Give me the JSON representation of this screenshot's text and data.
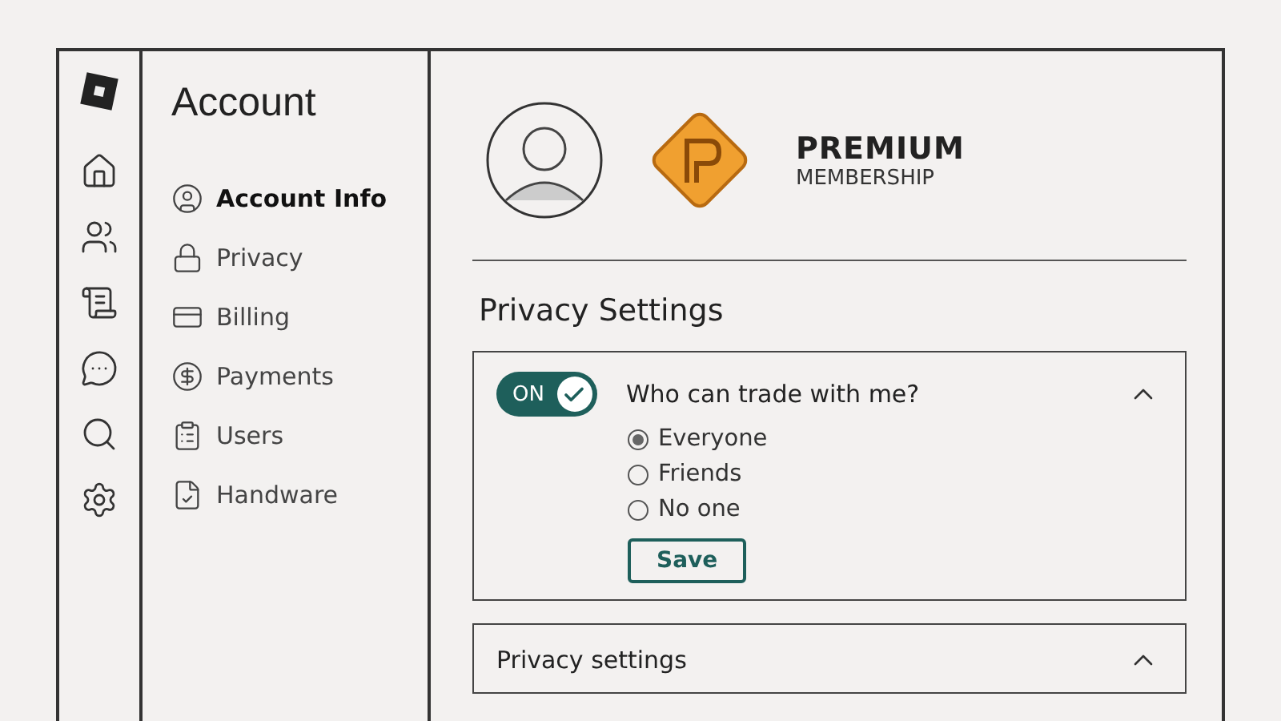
{
  "rail": {
    "items": [
      {
        "kind": "home",
        "selected": false
      },
      {
        "kind": "friends",
        "selected": false
      },
      {
        "kind": "scroll",
        "selected": false
      },
      {
        "kind": "chat",
        "selected": false
      },
      {
        "kind": "search",
        "selected": false
      },
      {
        "kind": "settings",
        "selected": false
      }
    ]
  },
  "sidebar": {
    "title": "Account",
    "items": [
      {
        "label": "Account Info",
        "kind": "user",
        "selected": true
      },
      {
        "label": "Privacy",
        "kind": "lock",
        "selected": false
      },
      {
        "label": "Billing",
        "kind": "card",
        "selected": false
      },
      {
        "label": "Payments",
        "kind": "dollar",
        "selected": false
      },
      {
        "label": "Users",
        "kind": "clipboard",
        "selected": false
      },
      {
        "label": "Handware",
        "kind": "file",
        "selected": false
      }
    ]
  },
  "membership": {
    "title": "PREMIUM",
    "subtitle": "MEMBERSHIP"
  },
  "section_title": "Privacy Settings",
  "panels": [
    {
      "title": "Who can trade with me?",
      "expanded": true,
      "toggle": {
        "label": "ON",
        "on": true
      },
      "options": [
        {
          "label": "Everyone",
          "selected": true
        },
        {
          "label": "Friends",
          "selected": false
        },
        {
          "label": "No one",
          "selected": false
        }
      ],
      "button": "Save"
    },
    {
      "title": "Privacy settings",
      "expanded": true
    }
  ]
}
